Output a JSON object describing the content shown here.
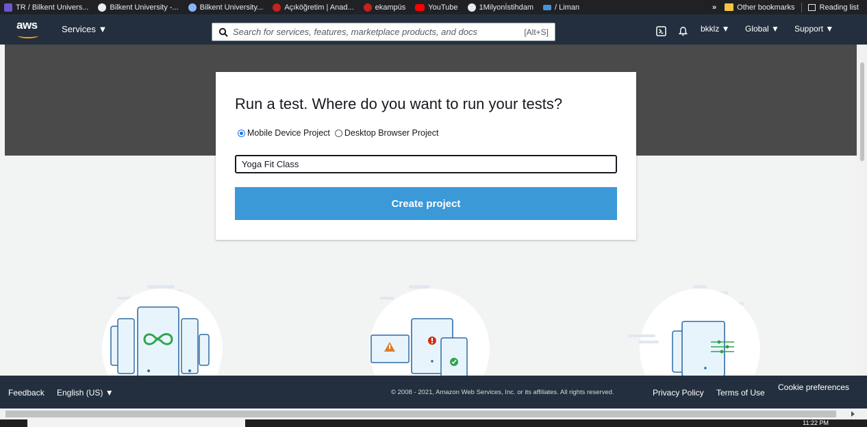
{
  "bookmarks": {
    "items": [
      {
        "label": "TR / Bilkent Univers...",
        "color": "#6e56cf"
      },
      {
        "label": "Bilkent University -...",
        "color": "#e8eaed"
      },
      {
        "label": "Bilkent University...",
        "color": "#8ab4f8"
      },
      {
        "label": "Açıköğretim | Anad...",
        "color": "#c5221f"
      },
      {
        "label": "ekampüs",
        "color": "#c5221f"
      },
      {
        "label": "YouTube",
        "color": "#ff0000"
      },
      {
        "label": "1Milyonİstihdam",
        "color": "#e8eaed"
      },
      {
        "label": "/ Liman",
        "color": "#4a90d9"
      }
    ],
    "overflow": "»",
    "other": "Other bookmarks",
    "reading_list": "Reading list"
  },
  "aws_nav": {
    "logo": "aws",
    "services": "Services ▼",
    "search_placeholder": "Search for services, features, marketplace products, and docs",
    "search_shortcut": "[Alt+S]",
    "user": "bkklz ▼",
    "region": "Global ▼",
    "support": "Support ▼"
  },
  "card": {
    "title": "Run a test. Where do you want to run your tests?",
    "option_mobile": "Mobile Device Project",
    "option_desktop": "Desktop Browser Project",
    "selected": "mobile",
    "project_name": "Yoga Fit Class",
    "create_button": "Create project"
  },
  "footer": {
    "feedback": "Feedback",
    "language": "English (US) ▼",
    "copyright": "© 2008 - 2021, Amazon Web Services, Inc. or its affiliates. All rights reserved.",
    "privacy": "Privacy Policy",
    "terms": "Terms of Use",
    "cookies": "Cookie preferences"
  },
  "taskbar": {
    "clock": "11:22 PM"
  },
  "colors": {
    "aws_nav": "#232f3e",
    "accent": "#3b99d8",
    "aws_orange": "#ff9900",
    "hero": "#4a4a4a",
    "illustration_green": "#2ea44f"
  }
}
